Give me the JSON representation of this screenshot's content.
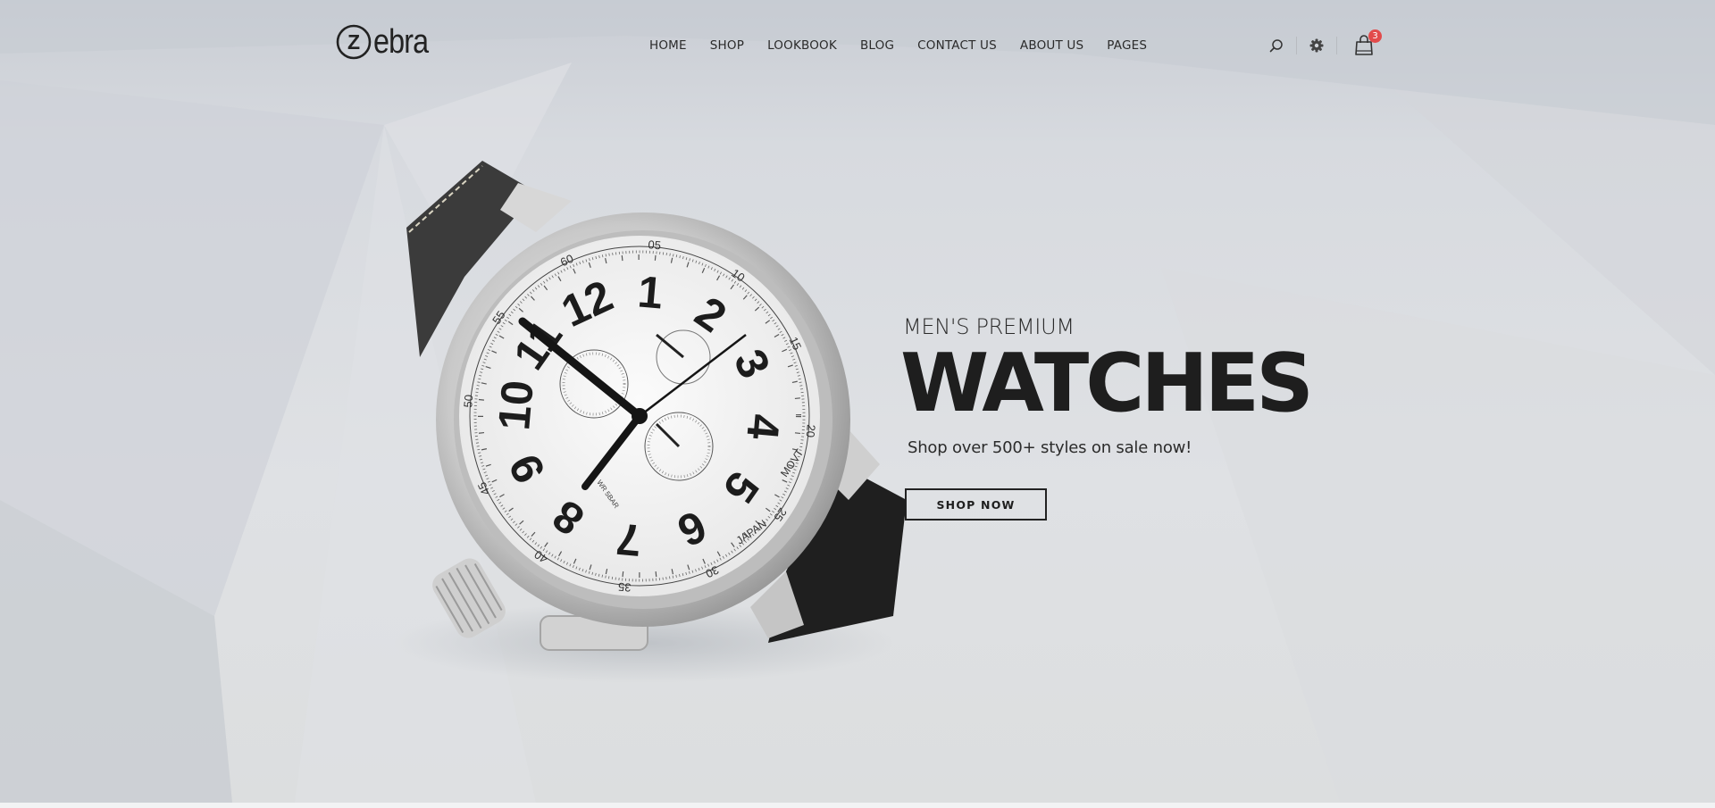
{
  "brand": {
    "logo_letter": "Z",
    "logo_text": "ebra"
  },
  "nav": {
    "items": [
      {
        "label": "HOME"
      },
      {
        "label": "SHOP"
      },
      {
        "label": "LOOKBOOK"
      },
      {
        "label": "BLOG"
      },
      {
        "label": "CONTACT US"
      },
      {
        "label": "ABOUT US"
      },
      {
        "label": "PAGES"
      }
    ]
  },
  "tools": {
    "search_icon": "search-icon",
    "settings_icon": "gear-icon",
    "cart_icon": "shopping-bag-icon",
    "cart_count": "3"
  },
  "hero": {
    "subtitle": "MEN'S PREMIUM",
    "title": "WATCHES",
    "tagline": "Shop over 500+ styles on sale now!",
    "button_label": "SHOP NOW"
  },
  "watch_dial": {
    "hour_numerals": [
      "12",
      "1",
      "2",
      "3",
      "4",
      "5",
      "6",
      "7",
      "8",
      "9",
      "10",
      "11"
    ],
    "minute_numerals": [
      "60",
      "05",
      "10",
      "15",
      "20",
      "25",
      "30",
      "35",
      "40",
      "45",
      "50",
      "55"
    ],
    "dial_text": [
      "MOVT",
      "JAPAN",
      "WR 5BAR"
    ]
  },
  "colors": {
    "text_dark": "#1e1e1e",
    "badge": "#e24b4b",
    "background": "#dcdfe3"
  }
}
